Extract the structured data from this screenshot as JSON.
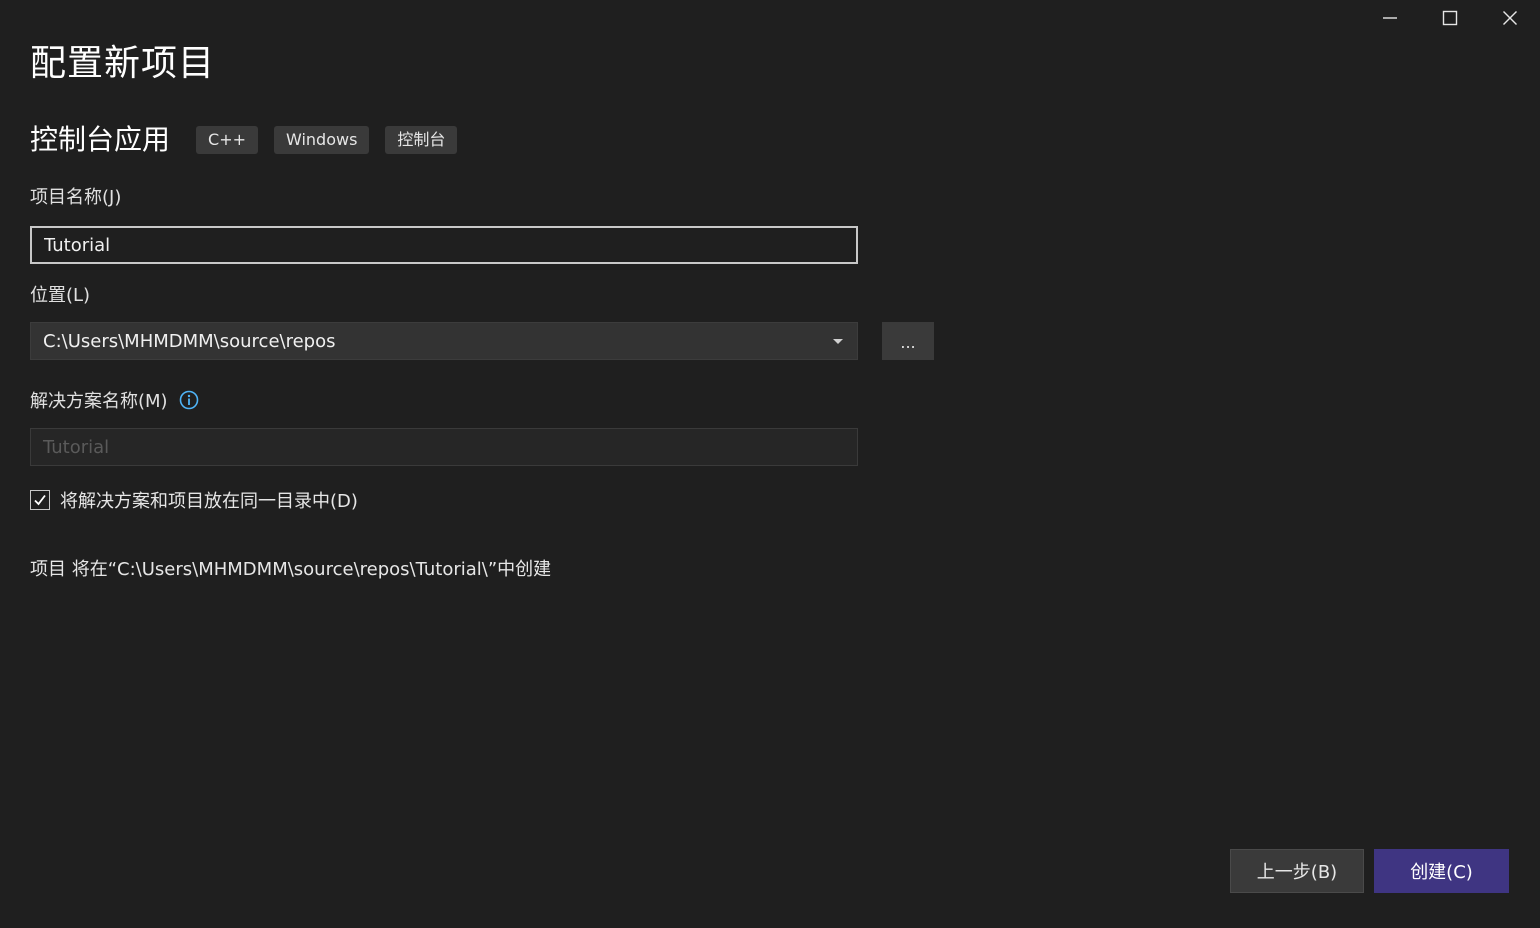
{
  "window": {
    "controls": [
      "minimize-icon",
      "maximize-icon",
      "close-icon"
    ]
  },
  "header": {
    "title": "配置新项目"
  },
  "template": {
    "name": "控制台应用",
    "tags": [
      "C++",
      "Windows",
      "控制台"
    ]
  },
  "form": {
    "project_name_label": "项目名称(J)",
    "project_name_value": "Tutorial",
    "location_label": "位置(L)",
    "location_value": "C:\\Users\\MHMDMM\\source\\repos",
    "browse_label": "...",
    "solution_name_label": "解决方案名称(M)",
    "solution_name_value": "Tutorial",
    "same_dir_label": "将解决方案和项目放在同一目录中(D)",
    "same_dir_checked": true,
    "path_note": "项目 将在“C:\\Users\\MHMDMM\\source\\repos\\Tutorial\\”中创建"
  },
  "footer": {
    "back_label": "上一步(B)",
    "create_label": "创建(C)"
  },
  "colors": {
    "background": "#1f1f1f",
    "accent": "#3f3582",
    "info_icon": "#4fb3f6"
  }
}
